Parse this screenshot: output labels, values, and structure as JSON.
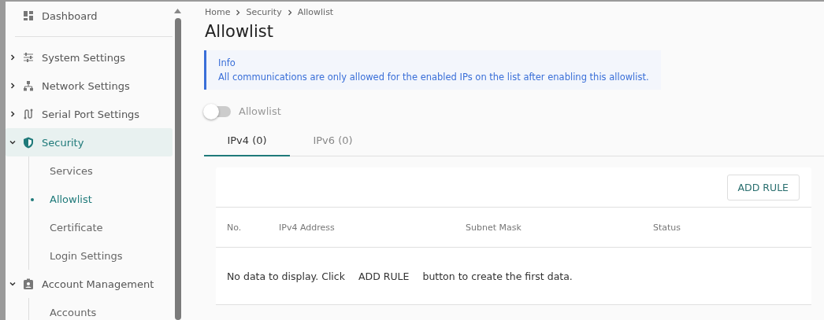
{
  "sidebar": {
    "items": [
      {
        "label": "Dashboard",
        "expandable": false,
        "selected": false
      },
      {
        "label": "System Settings",
        "expandable": true,
        "expanded": false,
        "selected": false
      },
      {
        "label": "Network Settings",
        "expandable": true,
        "expanded": false,
        "selected": false
      },
      {
        "label": "Serial Port Settings",
        "expandable": true,
        "expanded": false,
        "selected": false
      },
      {
        "label": "Security",
        "expandable": true,
        "expanded": true,
        "selected": true,
        "children": [
          {
            "label": "Services",
            "selected": false
          },
          {
            "label": "Allowlist",
            "selected": true
          },
          {
            "label": "Certificate",
            "selected": false
          },
          {
            "label": "Login Settings",
            "selected": false
          }
        ]
      },
      {
        "label": "Account Management",
        "expandable": true,
        "expanded": true,
        "selected": false,
        "children": [
          {
            "label": "Accounts",
            "selected": false
          }
        ]
      }
    ]
  },
  "breadcrumb": [
    "Home",
    "Security",
    "Allowlist"
  ],
  "page_title": "Allowlist",
  "info": {
    "title": "Info",
    "message": "All communications are only allowed for the enabled IPs on the list after enabling this allowlist."
  },
  "toggle": {
    "label": "Allowlist",
    "on": false
  },
  "tabs": [
    {
      "label": "IPv4 (0)",
      "selected": true
    },
    {
      "label": "IPv6 (0)",
      "selected": false
    }
  ],
  "table": {
    "add_button": "ADD RULE",
    "columns": [
      "No.",
      "IPv4 Address",
      "Subnet Mask",
      "Status"
    ],
    "empty": {
      "before": "No data to display. Click",
      "link": "ADD RULE",
      "after": "button to create the first data."
    }
  }
}
